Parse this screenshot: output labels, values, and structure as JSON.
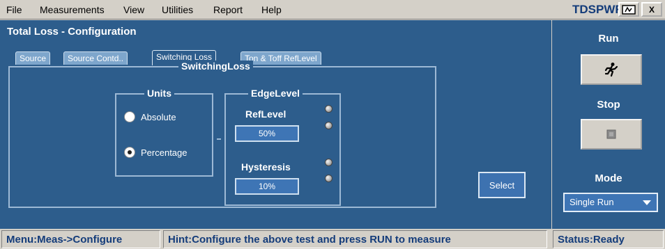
{
  "menu": {
    "items": [
      "File",
      "Measurements",
      "View",
      "Utilities",
      "Report",
      "Help"
    ],
    "app_title": "TDSPWR3",
    "close_label": "X"
  },
  "main": {
    "title": "Total Loss - Configuration",
    "tabs": [
      "Source",
      "Source Contd..",
      "Switching Loss",
      "Ton & Toff RefLevel"
    ],
    "active_tab": "Switching Loss",
    "switching_group": {
      "title": "SwitchingLoss",
      "units": {
        "title": "Units",
        "options": [
          "Absolute",
          "Percentage"
        ],
        "selected": "Percentage"
      },
      "edge_level": {
        "title": "EdgeLevel",
        "ref_level_label": "RefLevel",
        "ref_level_value": "50%",
        "hysteresis_label": "Hysteresis",
        "hysteresis_value": "10%"
      }
    },
    "select_label": "Select"
  },
  "side": {
    "run_label": "Run",
    "run_icon": "running-man-icon",
    "stop_label": "Stop",
    "stop_icon": "stop-square-icon",
    "mode_label": "Mode",
    "mode_value": "Single Run"
  },
  "status": {
    "menu_path": "Menu:Meas->Configure",
    "hint": "Hint:Configure the above test and press RUN to measure",
    "status": "Status:Ready"
  },
  "colors": {
    "panel_bg": "#2d5d8c",
    "field_bg": "#3e75b5",
    "chrome_bg": "#d4d0c8",
    "title_blue": "#143c7a"
  }
}
